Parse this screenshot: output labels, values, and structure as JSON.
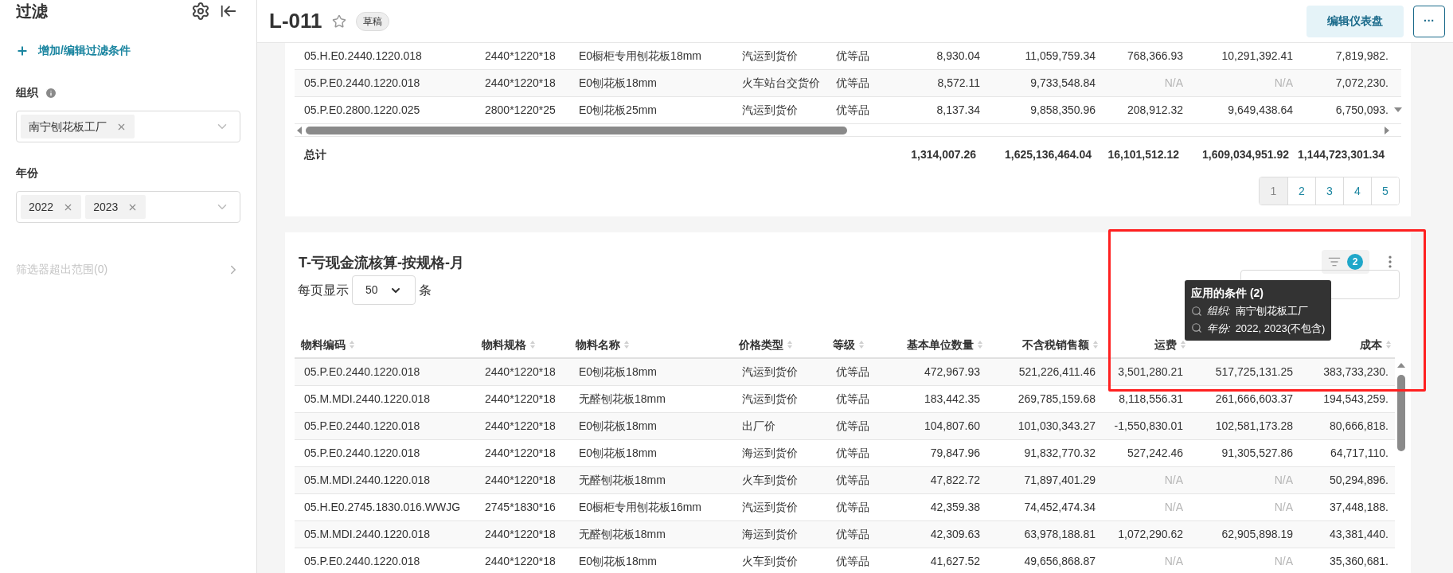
{
  "sidebar": {
    "title": "过滤",
    "add_filter": "增加/编辑过滤条件",
    "filters": [
      {
        "label": "组织",
        "info": true,
        "values": [
          "南宁刨花板工厂"
        ]
      },
      {
        "label": "年份",
        "info": false,
        "values": [
          "2022",
          "2023"
        ]
      }
    ],
    "out_of_scope": "筛选器超出范围(0)"
  },
  "header": {
    "title": "L-011",
    "starred": false,
    "badge": "草稿",
    "edit_button": "编辑仪表盘",
    "more_button": "···"
  },
  "top_table": {
    "rows": [
      [
        "05.H.E0.2440.1220.018",
        "2440*1220*18",
        "E0橱柜专用刨花板18mm",
        "汽运到货价",
        "优等品",
        "8,930.04",
        "11,059,759.34",
        "768,366.93",
        "10,291,392.41",
        "7,819,982."
      ],
      [
        "05.P.E0.2440.1220.018",
        "2440*1220*18",
        "E0刨花板18mm",
        "火车站台交货价",
        "优等品",
        "8,572.11",
        "9,733,548.84",
        {
          "text": "N/A",
          "kind": "missing"
        },
        {
          "text": "N/A",
          "kind": "missing"
        },
        "7,072,230."
      ],
      [
        "05.P.E0.2800.1220.025",
        "2800*1220*25",
        "E0刨花板25mm",
        "汽运到货价",
        "优等品",
        "8,137.34",
        "9,858,350.96",
        "208,912.32",
        "9,649,438.64",
        "6,750,093."
      ]
    ],
    "total_label": "总计",
    "totals": [
      "1,314,007.26",
      "1,625,136,464.04",
      "16,101,512.12",
      "1,609,034,951.92",
      "1,144,723,301.34"
    ],
    "pages": [
      {
        "label": "1",
        "selected": true
      },
      {
        "label": "2",
        "selected": false
      },
      {
        "label": "3",
        "selected": false
      },
      {
        "label": "4",
        "selected": false
      },
      {
        "label": "5",
        "selected": false
      }
    ]
  },
  "bottom_table": {
    "title": "T-亏现金流核算-按规格-月",
    "per_page_label": "每页显示",
    "per_page": "50",
    "per_page_unit": "条",
    "filter_count": "2",
    "tooltip": {
      "title": "应用的条件 (2)",
      "conditions": [
        {
          "name": "组织:",
          "value": "南宁刨花板工厂"
        },
        {
          "name": "年份:",
          "value": "2022, 2023(不包含)"
        }
      ]
    },
    "columns": [
      "物料编码",
      "物料规格",
      "物料名称",
      "价格类型",
      "等级",
      "基本单位数量",
      "不含税销售额",
      "运费",
      null,
      "成本"
    ],
    "rows": [
      [
        "05.P.E0.2440.1220.018",
        "2440*1220*18",
        "E0刨花板18mm",
        "汽运到货价",
        "优等品",
        "472,967.93",
        "521,226,411.46",
        "3,501,280.21",
        "517,725,131.25",
        "383,733,230."
      ],
      [
        "05.M.MDI.2440.1220.018",
        "2440*1220*18",
        "无醛刨花板18mm",
        "汽运到货价",
        "优等品",
        "183,442.35",
        "269,785,159.68",
        "8,118,556.31",
        "261,666,603.37",
        "194,543,259."
      ],
      [
        "05.P.E0.2440.1220.018",
        "2440*1220*18",
        "E0刨花板18mm",
        "出厂价",
        "优等品",
        "104,807.60",
        "101,030,343.27",
        "-1,550,830.01",
        "102,581,173.28",
        "80,666,818."
      ],
      [
        "05.P.E0.2440.1220.018",
        "2440*1220*18",
        "E0刨花板18mm",
        "海运到货价",
        "优等品",
        "79,847.96",
        "91,832,770.32",
        "527,242.46",
        "91,305,527.86",
        "64,717,110."
      ],
      [
        "05.M.MDI.2440.1220.018",
        "2440*1220*18",
        "无醛刨花板18mm",
        "火车到货价",
        "优等品",
        "47,822.72",
        "71,897,401.29",
        {
          "text": "N/A",
          "kind": "missing"
        },
        {
          "text": "N/A",
          "kind": "missing"
        },
        "50,294,896."
      ],
      [
        "05.H.E0.2745.1830.016.WWJG",
        "2745*1830*16",
        "E0橱柜专用刨花板16mm",
        "汽运到货价",
        "优等品",
        "42,359.38",
        "74,452,474.34",
        {
          "text": "N/A",
          "kind": "missing"
        },
        {
          "text": "N/A",
          "kind": "missing"
        },
        "37,448,188."
      ],
      [
        "05.M.MDI.2440.1220.018",
        "2440*1220*18",
        "无醛刨花板18mm",
        "海运到货价",
        "优等品",
        "42,309.63",
        "63,978,188.81",
        "1,072,290.62",
        "62,905,898.19",
        "43,381,440."
      ],
      [
        "05.P.E0.2440.1220.018",
        "2440*1220*18",
        "E0刨花板18mm",
        "火车到货价",
        "优等品",
        "41,627.52",
        "49,656,868.87",
        {
          "text": "N/A",
          "kind": "missing"
        },
        {
          "text": "N/A",
          "kind": "missing"
        },
        "35,360,681."
      ]
    ]
  },
  "highlight": true
}
